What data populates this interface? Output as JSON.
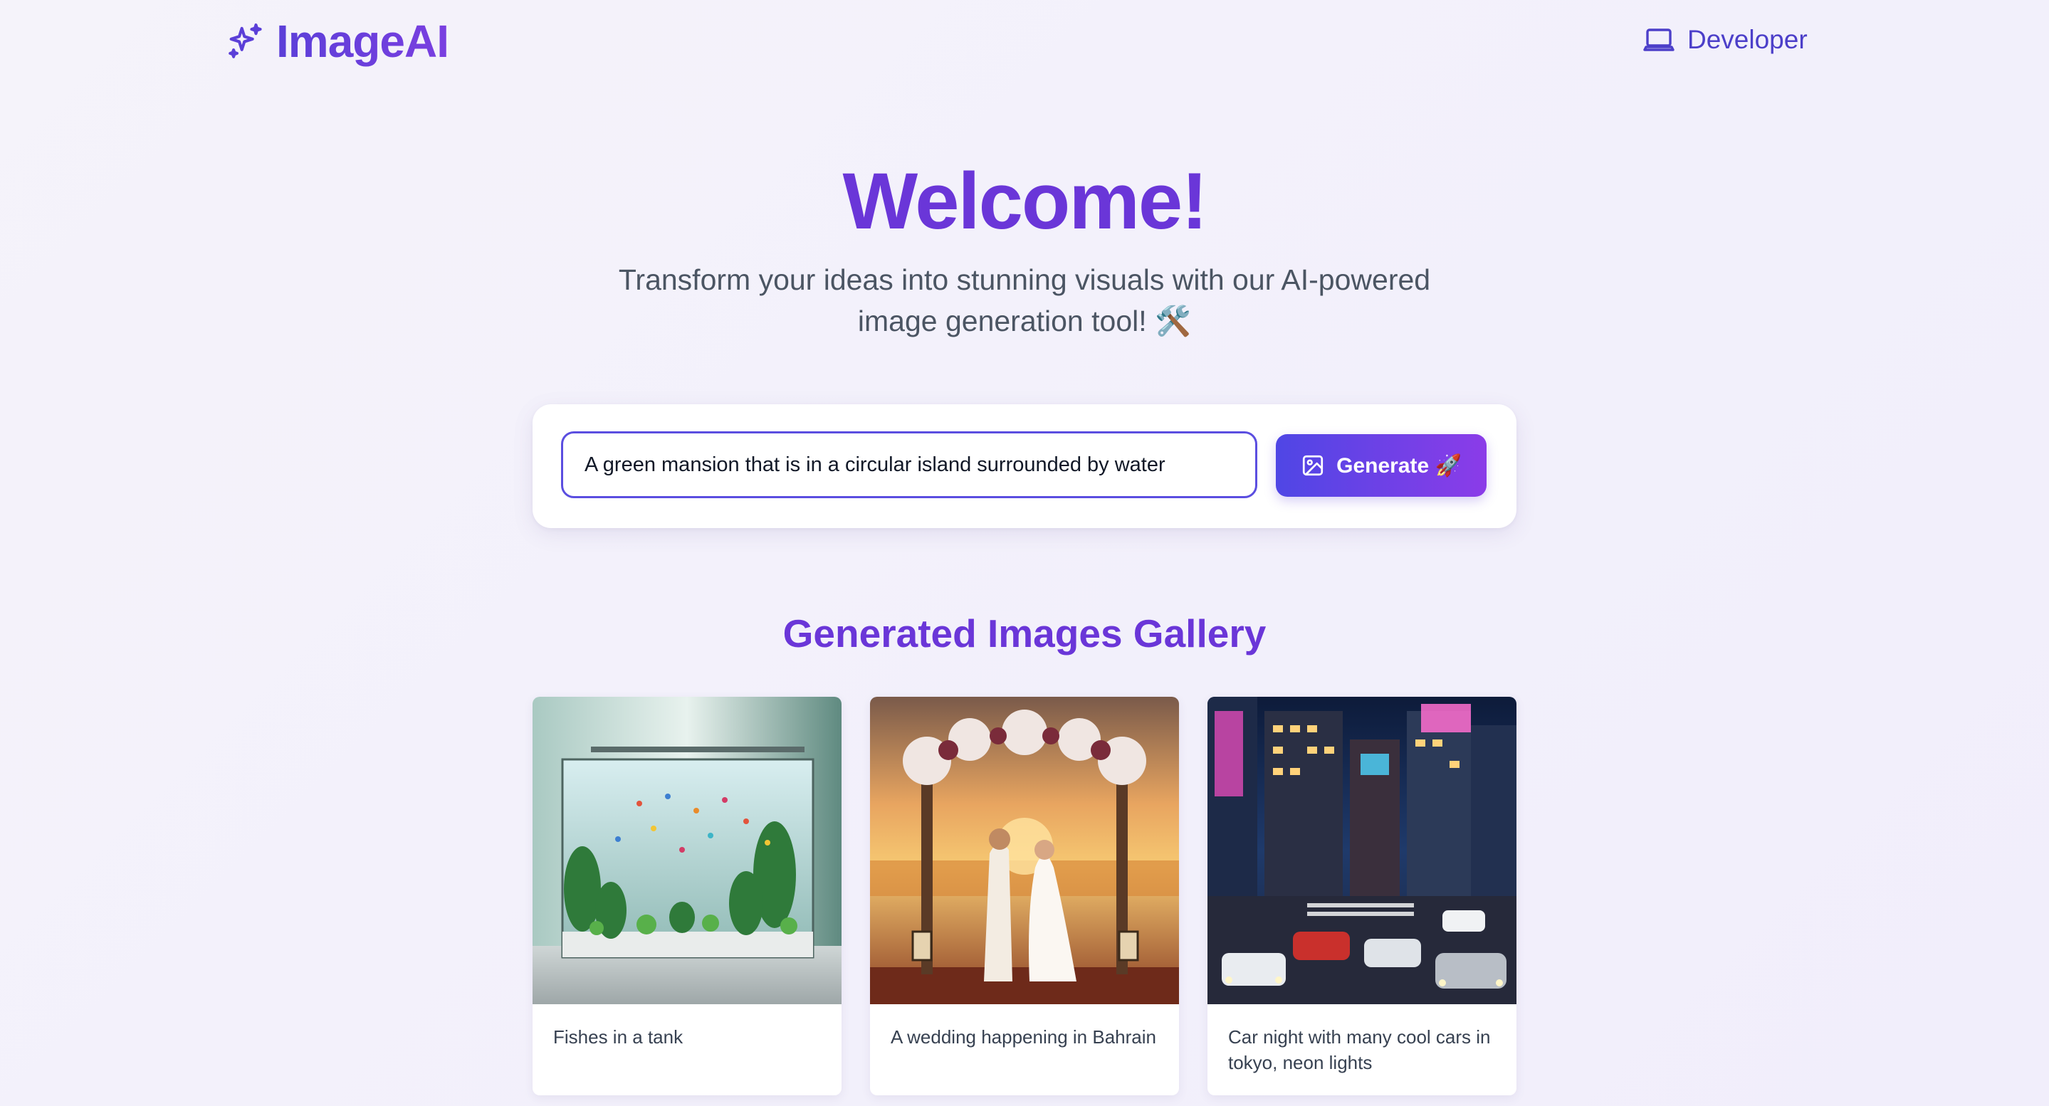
{
  "header": {
    "brand_name": "ImageAI",
    "brand_icon": "sparkles-icon",
    "developer_label": "Developer",
    "developer_icon": "laptop-icon"
  },
  "hero": {
    "title": "Welcome!",
    "subtitle": "Transform your ideas into stunning visuals with our AI-powered image generation tool! 🛠️"
  },
  "prompt": {
    "value": "A green mansion that is in a circular island surrounded by water",
    "generate_label": "Generate 🚀",
    "generate_icon": "image-icon"
  },
  "gallery": {
    "title": "Generated Images Gallery",
    "items": [
      {
        "caption": "Fishes in a tank"
      },
      {
        "caption": "A wedding happening in Bahrain"
      },
      {
        "caption": "Car night with many cool cars in tokyo, neon lights"
      }
    ]
  },
  "colors": {
    "accent": "#6a36d8",
    "button_start": "#4f46e5",
    "button_end": "#8b3ce8",
    "input_border": "#5b4ee0",
    "page_background": "#f3f1fb"
  }
}
